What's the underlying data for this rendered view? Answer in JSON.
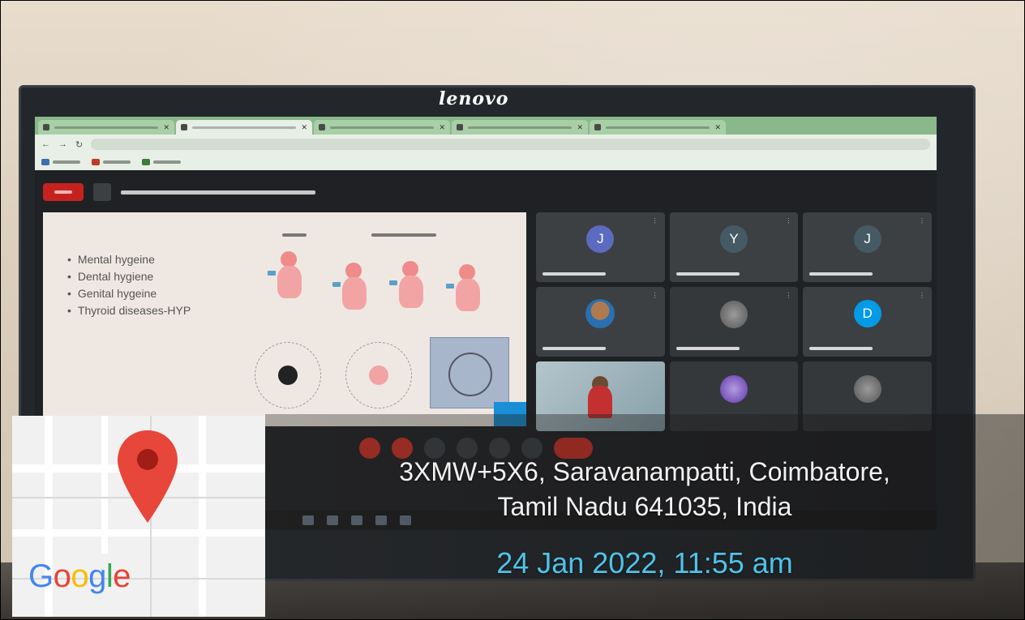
{
  "monitor": {
    "brand": "lenovo"
  },
  "slide": {
    "bullets": [
      "Mental hygeine",
      "Dental hygiene",
      "Genital hygeine",
      "Thyroid diseases-HYP"
    ]
  },
  "participants": [
    {
      "initial": "J",
      "color": "#5c6bc0"
    },
    {
      "initial": "Y",
      "color": "#455a64"
    },
    {
      "initial": "J",
      "color": "#455a64"
    },
    {
      "initial": "",
      "color": "#1e88e5"
    },
    {
      "initial": "",
      "color": "#607d8b"
    },
    {
      "initial": "D",
      "color": "#039be5"
    },
    {
      "initial": "",
      "color": "#888888"
    },
    {
      "initial": "",
      "color": "#7e57c2"
    },
    {
      "initial": "",
      "color": "#757575"
    }
  ],
  "location": {
    "address_line1": "3XMW+5X6, Saravanampatti, Coimbatore,",
    "address_line2": "Tamil Nadu 641035, India",
    "datetime": "24 Jan 2022, 11:55 am"
  },
  "map": {
    "pin_color": "#e8463a",
    "logo_letters": [
      {
        "ch": "G",
        "color": "#4285f4"
      },
      {
        "ch": "o",
        "color": "#ea4335"
      },
      {
        "ch": "o",
        "color": "#fbbc05"
      },
      {
        "ch": "g",
        "color": "#4285f4"
      },
      {
        "ch": "l",
        "color": "#34a853"
      },
      {
        "ch": "e",
        "color": "#ea4335"
      }
    ]
  }
}
